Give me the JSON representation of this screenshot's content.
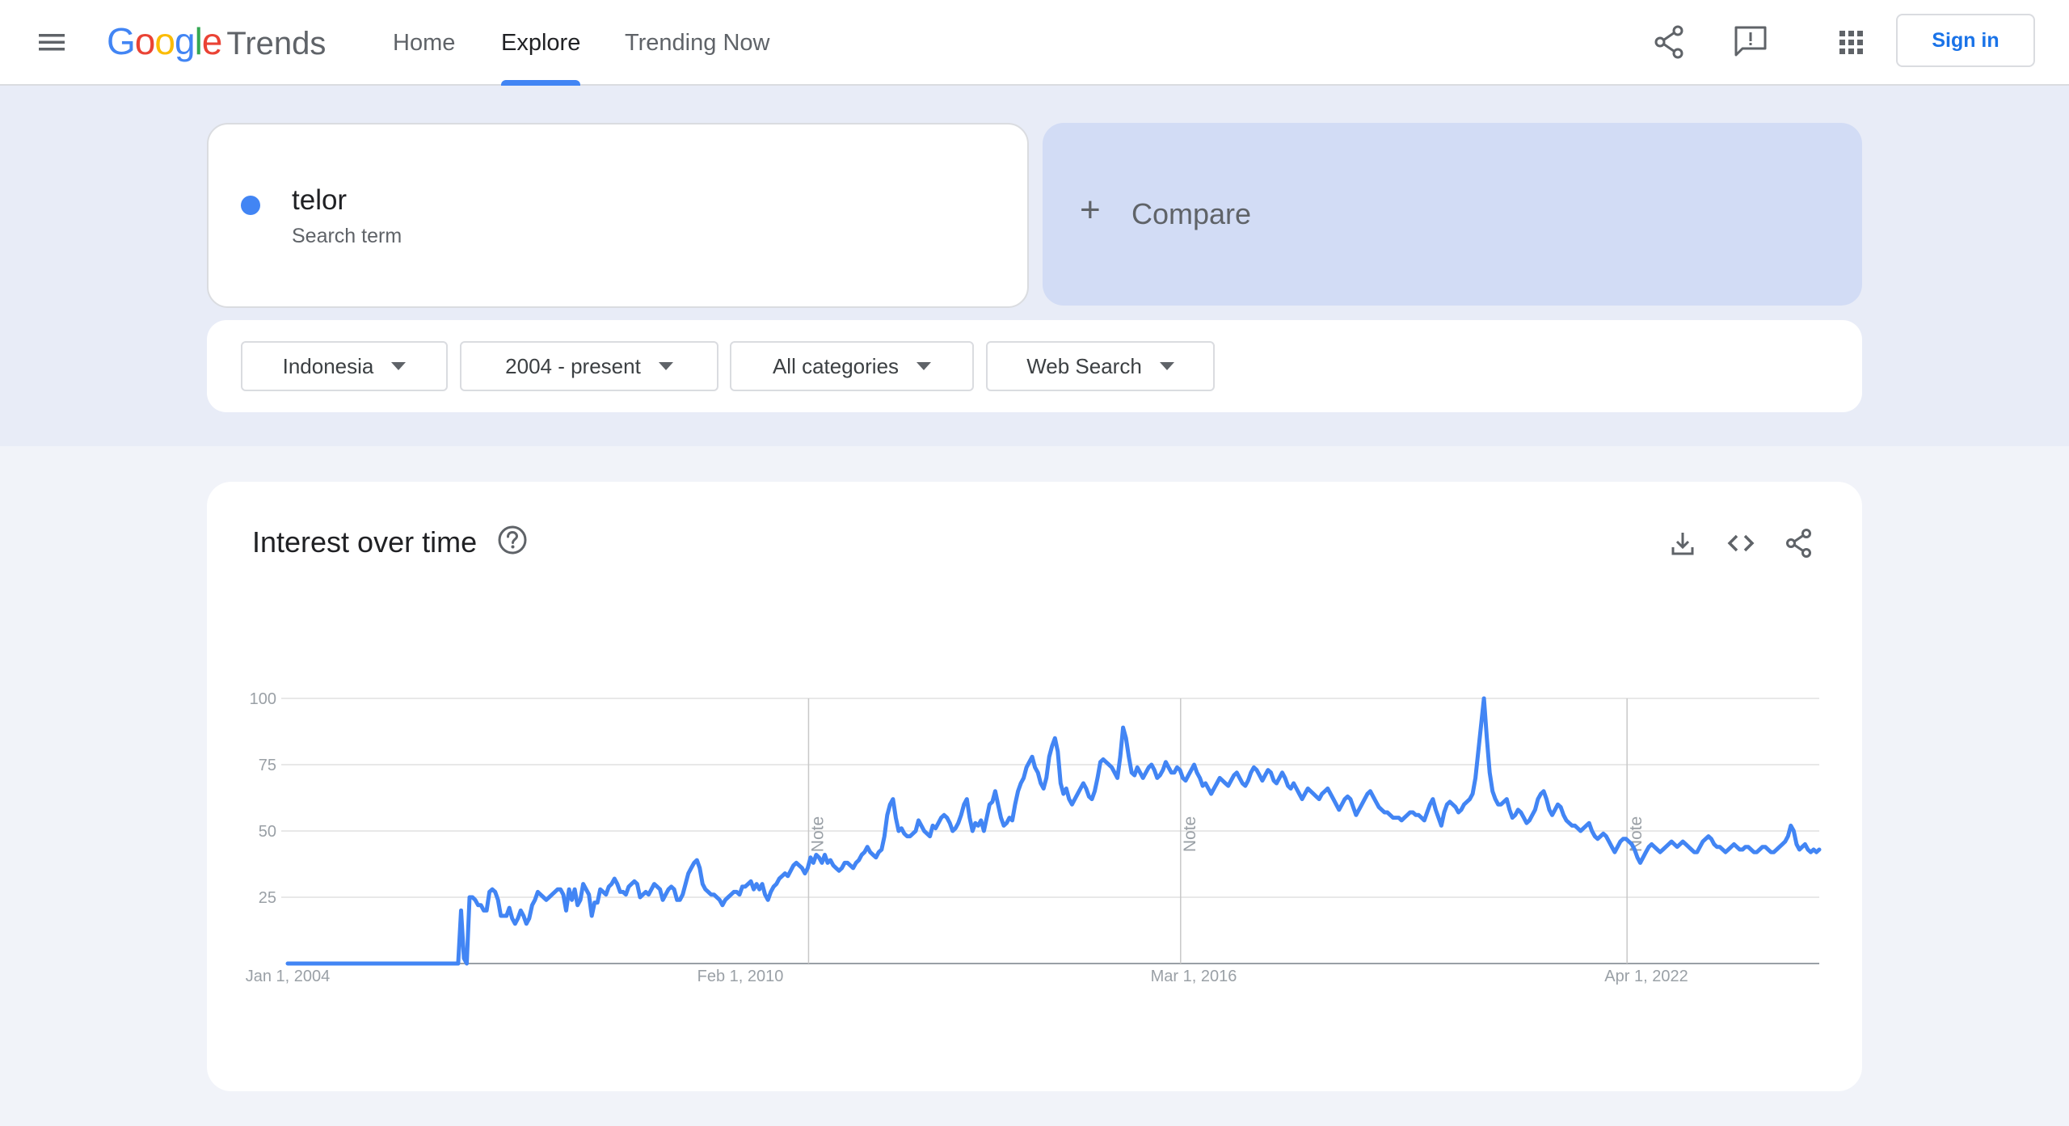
{
  "header": {
    "logo_google": "Google",
    "logo_trends": "Trends",
    "nav": [
      {
        "label": "Home",
        "active": false
      },
      {
        "label": "Explore",
        "active": true
      },
      {
        "label": "Trending Now",
        "active": false
      }
    ],
    "icons": [
      "menu-icon",
      "share-icon",
      "feedback-icon",
      "apps-icon"
    ],
    "sign_in_label": "Sign in"
  },
  "search": {
    "term": "telor",
    "term_type": "Search term",
    "term_color": "#4285f4",
    "compare_label": "Compare"
  },
  "filters": [
    {
      "label": "Indonesia"
    },
    {
      "label": "2004 - present"
    },
    {
      "label": "All categories"
    },
    {
      "label": "Web Search"
    }
  ],
  "interest": {
    "title": "Interest over time",
    "icons": [
      "help-icon",
      "download-icon",
      "embed-icon",
      "share-icon"
    ]
  },
  "chart_data": {
    "type": "line",
    "title": "Interest over time",
    "series": [
      {
        "name": "telor",
        "color": "#4285f4",
        "x_start": "2004-01",
        "x_end": "2024-08",
        "frequency": "monthly",
        "values": [
          0,
          0,
          0,
          0,
          0,
          0,
          0,
          0,
          0,
          0,
          0,
          0,
          0,
          0,
          0,
          0,
          0,
          0,
          0,
          0,
          0,
          0,
          0,
          0,
          0,
          0,
          0,
          0,
          0,
          0,
          0,
          0,
          0,
          0,
          0,
          0,
          0,
          0,
          0,
          0,
          0,
          0,
          0,
          0,
          0,
          0,
          0,
          0,
          0,
          0,
          0,
          0,
          0,
          0,
          0,
          0,
          0,
          0,
          0,
          0,
          0,
          20,
          2,
          0,
          25,
          25,
          24,
          22,
          22,
          20,
          20,
          27,
          28,
          27,
          24,
          18,
          18,
          18,
          21,
          17,
          15,
          17,
          20,
          18,
          15,
          17,
          22,
          24,
          27,
          26,
          25,
          24,
          25,
          26,
          27,
          28,
          28,
          26,
          20,
          28,
          24,
          28,
          22,
          24,
          30,
          28,
          26,
          18,
          23,
          23,
          28,
          27,
          26,
          29,
          30,
          32,
          30,
          27,
          27,
          26,
          29,
          30,
          31,
          30,
          25,
          26,
          27,
          26,
          28,
          30,
          29,
          28,
          24,
          26,
          28,
          29,
          28,
          24,
          24,
          26,
          30,
          34,
          36,
          38,
          39,
          36,
          30,
          28,
          27,
          26,
          26,
          25,
          24,
          22,
          24,
          25,
          26,
          27,
          27,
          26,
          29,
          29,
          30,
          31,
          28,
          30,
          28,
          30,
          26,
          24,
          27,
          29,
          30,
          32,
          33,
          34,
          33,
          35,
          37,
          38,
          37,
          36,
          34,
          36,
          40,
          38,
          41,
          40,
          38,
          41,
          38,
          39,
          37,
          36,
          35,
          36,
          38,
          38,
          37,
          36,
          38,
          39,
          41,
          42,
          44,
          42,
          41,
          40,
          42,
          43,
          48,
          56,
          60,
          62,
          55,
          50,
          51,
          49,
          48,
          48,
          49,
          50,
          54,
          52,
          50,
          49,
          48,
          52,
          51,
          53,
          55,
          56,
          55,
          53,
          50,
          51,
          53,
          56,
          60,
          62,
          55,
          50,
          53,
          52,
          54,
          50,
          55,
          60,
          61,
          65,
          60,
          55,
          52,
          53,
          55,
          54,
          60,
          65,
          68,
          70,
          74,
          76,
          78,
          74,
          72,
          68,
          66,
          70,
          78,
          82,
          85,
          80,
          68,
          64,
          66,
          62,
          60,
          62,
          64,
          66,
          68,
          66,
          63,
          62,
          65,
          70,
          76,
          77,
          76,
          75,
          74,
          72,
          70,
          78,
          89,
          85,
          78,
          72,
          71,
          74,
          72,
          70,
          72,
          74,
          75,
          73,
          70,
          71,
          73,
          76,
          74,
          72,
          72,
          74,
          73,
          70,
          69,
          71,
          73,
          75,
          72,
          70,
          67,
          68,
          66,
          64,
          66,
          68,
          70,
          69,
          68,
          67,
          69,
          71,
          72,
          70,
          68,
          67,
          69,
          72,
          74,
          73,
          71,
          69,
          71,
          73,
          72,
          69,
          68,
          70,
          72,
          70,
          67,
          66,
          68,
          66,
          64,
          62,
          64,
          66,
          65,
          64,
          63,
          62,
          64,
          65,
          66,
          64,
          62,
          60,
          58,
          60,
          62,
          63,
          62,
          59,
          56,
          58,
          60,
          62,
          64,
          65,
          63,
          61,
          59,
          58,
          57,
          57,
          56,
          55,
          55,
          55,
          54,
          55,
          56,
          57,
          57,
          56,
          56,
          55,
          54,
          57,
          60,
          62,
          58,
          55,
          52,
          57,
          60,
          61,
          60,
          59,
          57,
          58,
          60,
          61,
          62,
          64,
          70,
          80,
          90,
          100,
          85,
          72,
          65,
          62,
          60,
          60,
          61,
          62,
          58,
          55,
          56,
          58,
          57,
          55,
          53,
          54,
          56,
          58,
          62,
          64,
          65,
          62,
          58,
          56,
          58,
          60,
          59,
          56,
          54,
          53,
          52,
          52,
          51,
          50,
          51,
          52,
          53,
          50,
          48,
          47,
          48,
          49,
          48,
          46,
          44,
          42,
          44,
          46,
          47,
          47,
          46,
          45,
          43,
          40,
          38,
          40,
          42,
          44,
          45,
          44,
          43,
          42,
          43,
          44,
          45,
          46,
          45,
          44,
          45,
          46,
          45,
          44,
          43,
          42,
          42,
          44,
          46,
          47,
          48,
          47,
          45,
          44,
          44,
          43,
          42,
          43,
          44,
          45,
          44,
          43,
          43,
          44,
          44,
          43,
          42,
          42,
          43,
          44,
          44,
          43,
          42,
          42,
          43,
          44,
          45,
          46,
          48,
          52,
          50,
          45,
          43,
          44,
          45,
          43,
          42,
          43,
          42,
          43
        ]
      }
    ],
    "x_tick_labels": [
      "Jan 1, 2004",
      "Feb 1, 2010",
      "Mar 1, 2016",
      "Apr 1, 2022"
    ],
    "y_ticks": [
      25,
      50,
      75,
      100
    ],
    "ylim": [
      0,
      100
    ],
    "annotations": [
      {
        "label": "Note",
        "date": "2011-01"
      },
      {
        "label": "Note",
        "date": "2016-01"
      },
      {
        "label": "Note",
        "date": "2022-01"
      }
    ],
    "grid": true,
    "legend": "none"
  }
}
